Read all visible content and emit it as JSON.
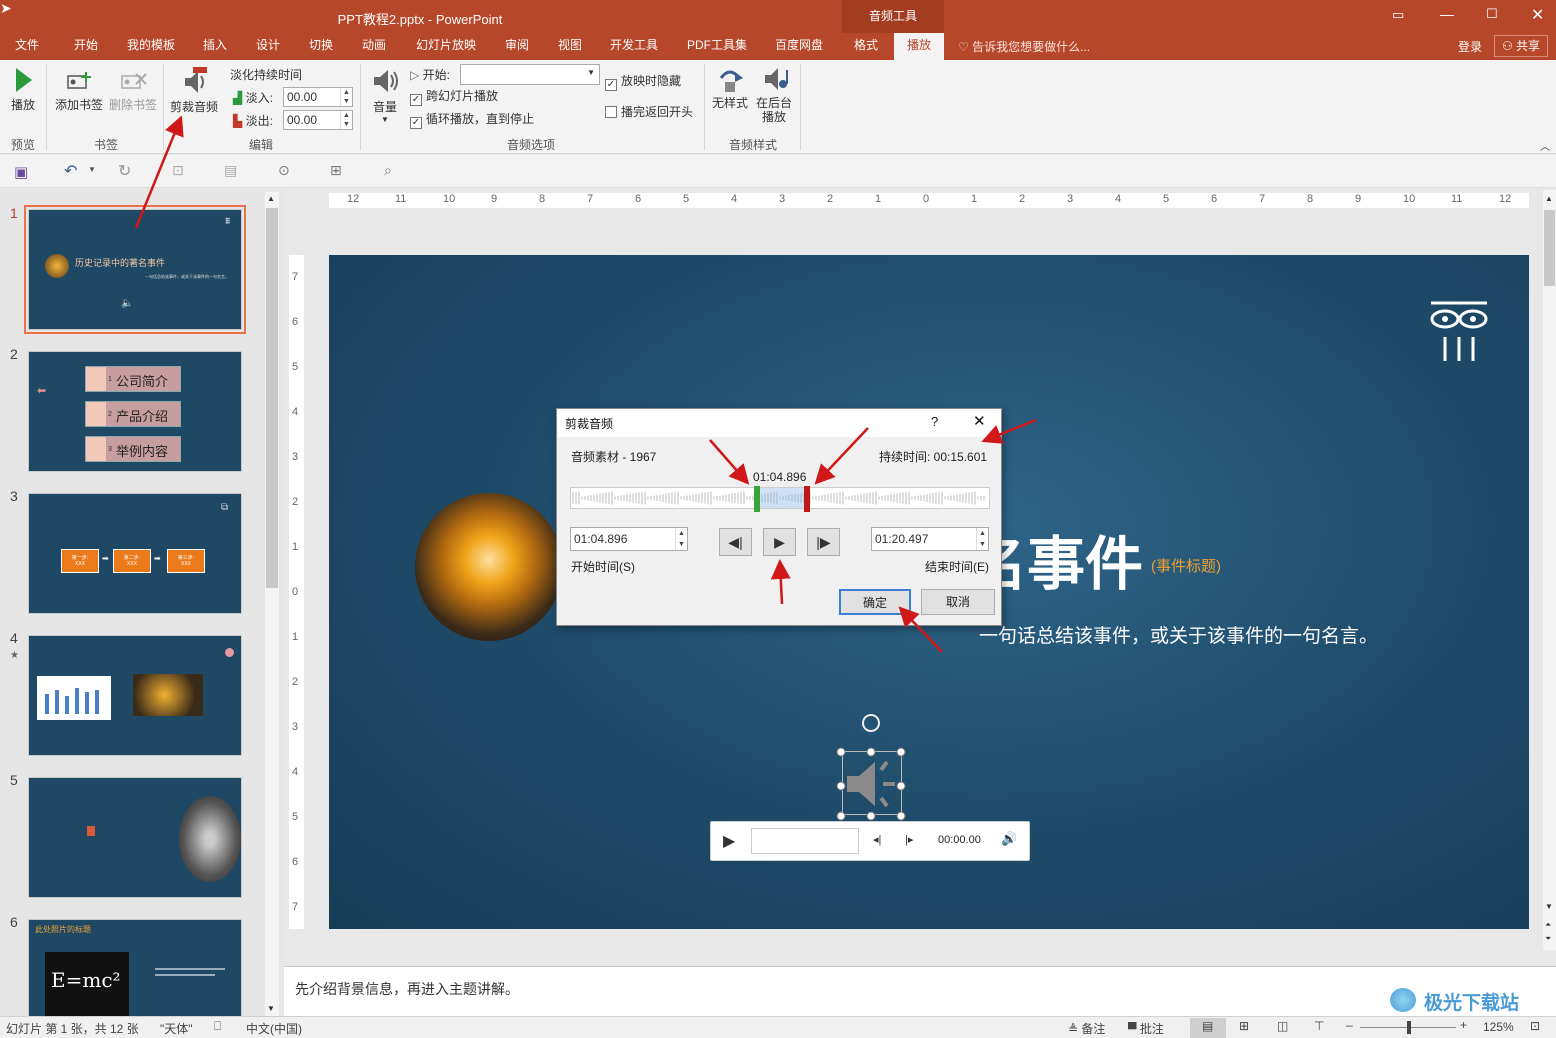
{
  "window": {
    "title": "PPT教程2.pptx - PowerPoint",
    "context_tab_group": "音频工具",
    "login": "登录",
    "share": "共享"
  },
  "tabs": [
    "文件",
    "开始",
    "我的模板",
    "插入",
    "设计",
    "切换",
    "动画",
    "幻灯片放映",
    "审阅",
    "视图",
    "开发工具",
    "PDF工具集",
    "百度网盘",
    "格式",
    "播放"
  ],
  "active_tab": "播放",
  "tell_me": "告诉我您想要做什么...",
  "ribbon": {
    "play": "播放",
    "add_bookmark": "添加书签",
    "remove_bookmark": "删除书签",
    "trim_audio": "剪裁音频",
    "fade_duration": "淡化持续时间",
    "fade_in_label": "淡入:",
    "fade_in_value": "00.00",
    "fade_out_label": "淡出:",
    "fade_out_value": "00.00",
    "volume": "音量",
    "start_label": "开始:",
    "start_value": "",
    "play_across_slides": "跨幻灯片播放",
    "loop_until_stopped": "循环播放，直到停止",
    "hide_during_show": "放映时隐藏",
    "rewind_after_playing": "播完返回开头",
    "no_style": "无样式",
    "play_in_background": "在后台播放",
    "groups": {
      "preview": "预览",
      "bookmarks": "书签",
      "editing": "编辑",
      "audio_options": "音频选项",
      "audio_styles": "音频样式"
    },
    "checks": {
      "play_across_slides": true,
      "loop_until_stopped": true,
      "hide_during_show": true,
      "rewind_after_playing": false
    }
  },
  "ruler_top": [
    "12",
    "11",
    "10",
    "9",
    "8",
    "7",
    "6",
    "5",
    "4",
    "3",
    "2",
    "1",
    "0",
    "1",
    "2",
    "3",
    "4",
    "5",
    "6",
    "7",
    "8",
    "9",
    "10",
    "11",
    "12"
  ],
  "ruler_left": [
    "7",
    "6",
    "5",
    "4",
    "3",
    "2",
    "1",
    "0",
    "1",
    "2",
    "3",
    "4",
    "5",
    "6",
    "7"
  ],
  "thumbnails": [
    {
      "num": "1",
      "title": "历史记录中的著名事件",
      "sub": "一句话总结该事件，或关于该事件的一句名言。"
    },
    {
      "num": "2",
      "items": [
        "公司简介",
        "产品介绍",
        "举例内容"
      ],
      "item_nums": [
        "1",
        "2",
        "3"
      ]
    },
    {
      "num": "3",
      "steps": [
        "第一步:",
        "第二步:",
        "第三步:"
      ],
      "step_sub": "XXX"
    },
    {
      "num": "4"
    },
    {
      "num": "5"
    },
    {
      "num": "6",
      "title": "此处照片的标题",
      "formula": "E=mc²"
    }
  ],
  "slide": {
    "title_visible": "名事件",
    "title_tag": "(事件标题)",
    "quote": "一句话总结该事件，或关于该事件的一句名言。",
    "player_time": "00:00.00"
  },
  "dialog": {
    "title": "剪裁音频",
    "help": "?",
    "media_name": "音频素材 - 1967",
    "duration_label": "持续时间: 00:15.601",
    "marker_time": "01:04.896",
    "start_time_value": "01:04.896",
    "end_time_value": "01:20.497",
    "start_time_label": "开始时间(S)",
    "end_time_label": "结束时间(E)",
    "ok": "确定",
    "cancel": "取消"
  },
  "notes_text": "先介绍背景信息，再进入主题讲解。",
  "status": {
    "slide_info": "幻灯片 第 1 张，共 12 张",
    "theme": "\"天体\"",
    "language": "中文(中国)",
    "notes": "备注",
    "comments": "批注",
    "zoom": "125%"
  },
  "watermark": "极光下载站",
  "colors": {
    "accent": "#b7472a",
    "slide_bg": "#1e4a68",
    "arrow": "#d01818",
    "orange": "#f0a030"
  }
}
